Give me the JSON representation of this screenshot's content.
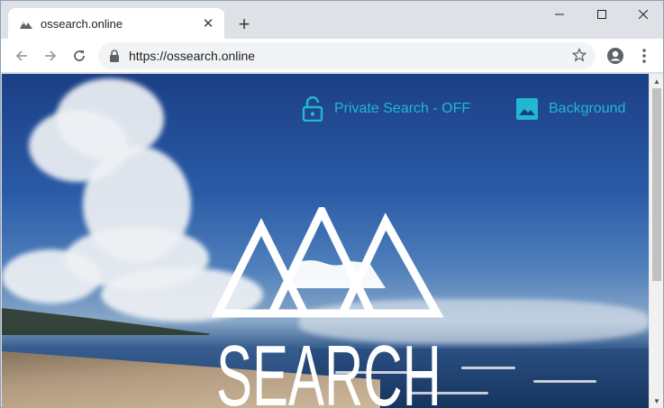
{
  "tab": {
    "title": "ossearch.online",
    "favicon": "mountain-logo-icon"
  },
  "window_controls": {
    "minimize": "minimize-icon",
    "maximize": "maximize-icon",
    "close": "close-icon"
  },
  "toolbar": {
    "url": "https://ossearch.online"
  },
  "page": {
    "private_search_label": "Private Search - OFF",
    "background_label": "Background",
    "logo_text": "SEARCH",
    "accent_color": "#23b8d0"
  }
}
